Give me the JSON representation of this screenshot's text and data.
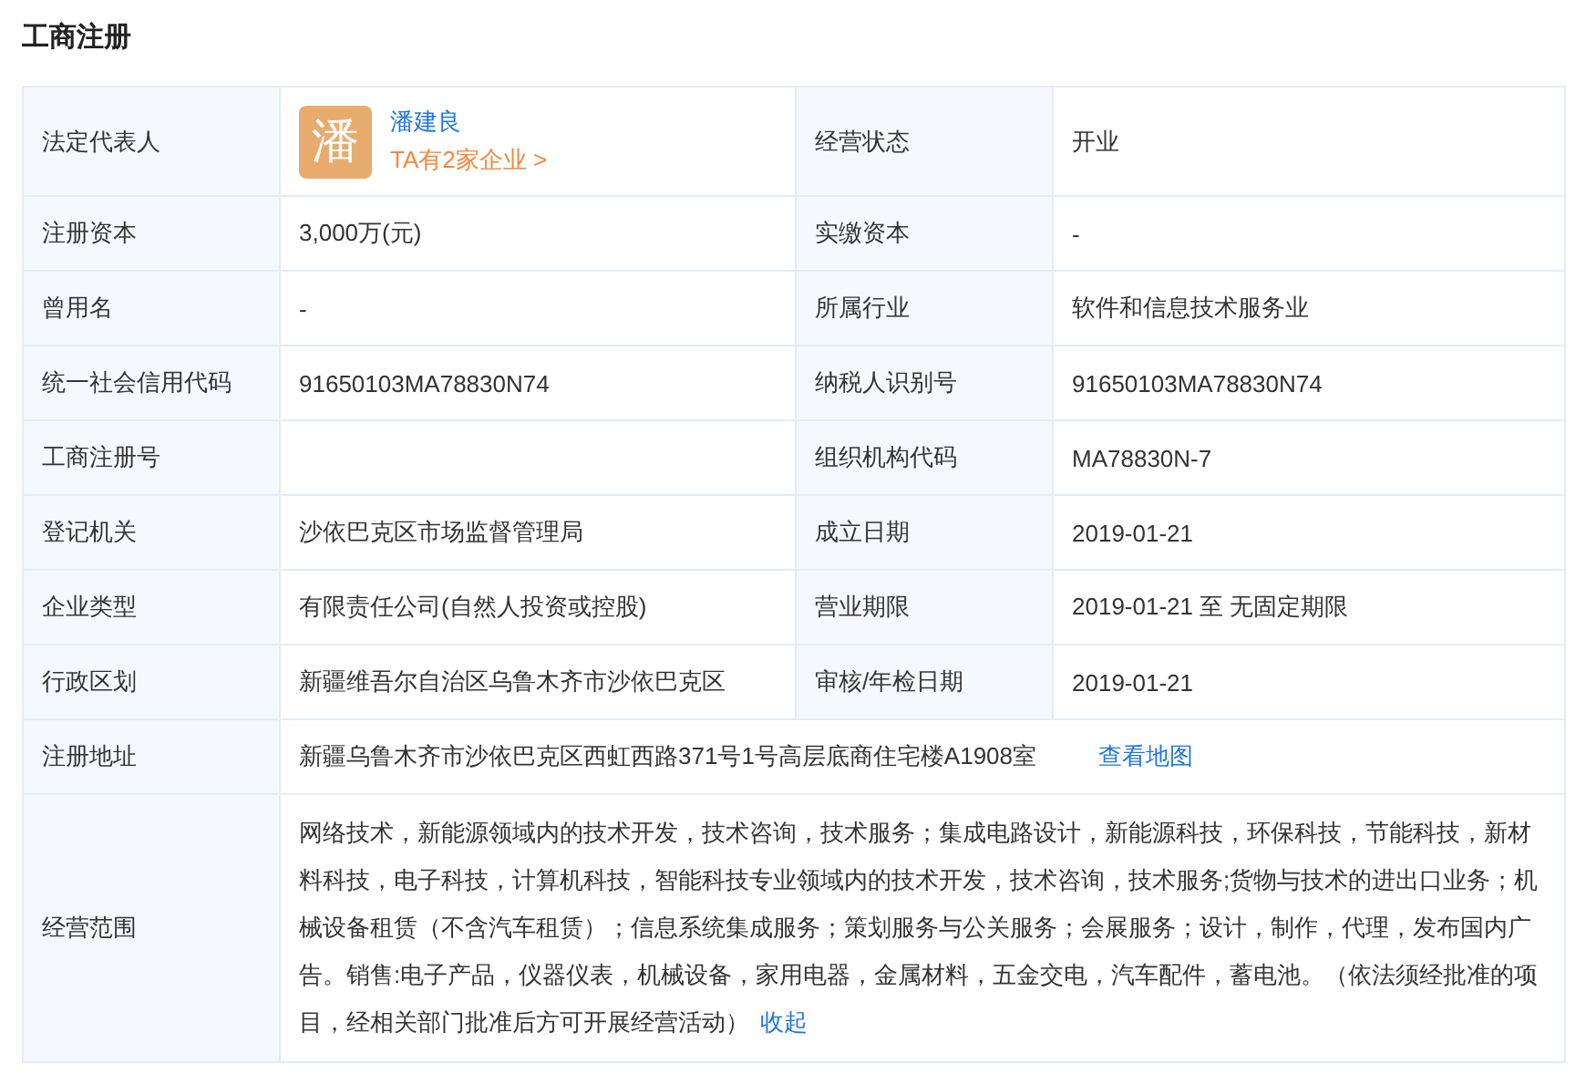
{
  "section_title": "工商注册",
  "fields": [
    {
      "kind": "person",
      "label": "法定代表人",
      "avatar": "潘",
      "name": "潘建良",
      "companies_link": "TA有2家企业 >"
    },
    {
      "kind": "text",
      "label": "经营状态",
      "value": "开业"
    },
    {
      "kind": "text",
      "label": "注册资本",
      "value": "3,000万(元)"
    },
    {
      "kind": "text",
      "label": "实缴资本",
      "value": "-"
    },
    {
      "kind": "text",
      "label": "曾用名",
      "value": "-"
    },
    {
      "kind": "text",
      "label": "所属行业",
      "value": "软件和信息技术服务业"
    },
    {
      "kind": "text",
      "label": "统一社会信用代码",
      "value": "91650103MA78830N74"
    },
    {
      "kind": "text",
      "label": "纳税人识别号",
      "value": "91650103MA78830N74"
    },
    {
      "kind": "text",
      "label": "工商注册号"
    },
    {
      "kind": "text",
      "label": "组织机构代码",
      "value": "MA78830N-7"
    },
    {
      "kind": "text",
      "label": "登记机关",
      "value": "沙依巴克区市场监督管理局"
    },
    {
      "kind": "text",
      "label": "成立日期",
      "value": "2019-01-21"
    },
    {
      "kind": "text",
      "label": "企业类型",
      "value": "有限责任公司(自然人投资或控股)"
    },
    {
      "kind": "text",
      "label": "营业期限",
      "value": "2019-01-21 至 无固定期限"
    },
    {
      "kind": "text",
      "label": "行政区划",
      "value": "新疆维吾尔自治区乌鲁木齐市沙依巴克区"
    },
    {
      "kind": "text",
      "label": "审核/年检日期",
      "value": "2019-01-21"
    },
    {
      "kind": "address",
      "label": "注册地址",
      "value": "新疆乌鲁木齐市沙依巴克区西虹西路371号1号高层底商住宅楼A1908室",
      "link": "查看地图"
    },
    {
      "kind": "scope",
      "label": "经营范围",
      "value": "网络技术，新能源领域内的技术开发，技术咨询，技术服务；集成电路设计，新能源科技，环保科技，节能科技，新材料科技，电子科技，计算机科技，智能科技专业领域内的技术开发，技术咨询，技术服务;货物与技术的进出口业务；机械设备租赁（不含汽车租赁）；信息系统集成服务；策划服务与公关服务；会展服务；设计，制作，代理，发布国内广告。销售:电子产品，仪器仪表，机械设备，家用电器，金属材料，五金交电，汽车配件，蓄电池。（依法须经批准的项目，经相关部门批准后方可开展经营活动）",
      "link": "收起"
    }
  ]
}
